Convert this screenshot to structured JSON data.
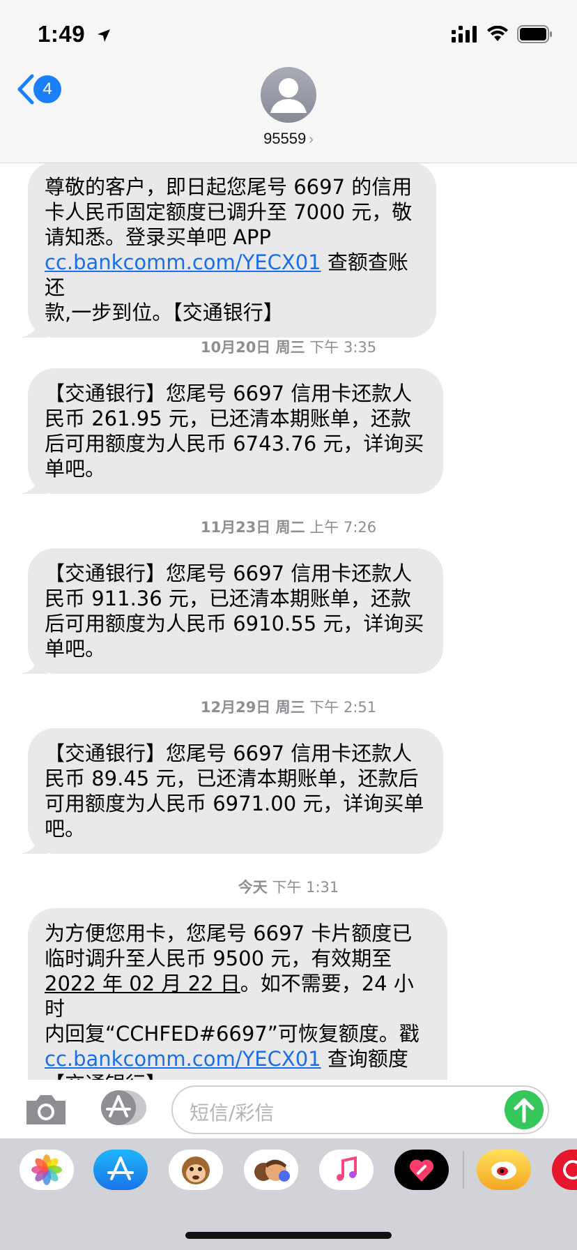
{
  "status_bar": {
    "time": "1:49"
  },
  "header": {
    "unread_count": "4",
    "contact_name": "95559",
    "chevron": "›"
  },
  "messages": [
    {
      "parts": [
        "尊敬的客户，即日起您尾号 6697 的信用",
        "卡人民币固定额度已调升至 7000 元，敬",
        "请知悉。登录买单吧 APP"
      ],
      "link": "cc.bankcomm.com/YECX01",
      "after_link": " 查额查账还",
      "tail": "款,一步到位。【交通银行】"
    },
    {
      "timestamp_date": "10月20日 周三",
      "timestamp_time": " 下午 3:35",
      "lines": [
        "【交通银行】您尾号 6697 信用卡还款人",
        "民币 261.95 元，已还清本期账单，还款",
        "后可用额度为人民币 6743.76 元，详询买",
        "单吧。"
      ]
    },
    {
      "timestamp_date": "11月23日 周二",
      "timestamp_time": " 上午 7:26",
      "lines": [
        "【交通银行】您尾号 6697 信用卡还款人",
        "民币 911.36 元，已还清本期账单，还款",
        "后可用额度为人民币 6910.55 元，详询买",
        "单吧。"
      ]
    },
    {
      "timestamp_date": "12月29日 周三",
      "timestamp_time": " 下午 2:51",
      "lines": [
        "【交通银行】您尾号 6697 信用卡还款人",
        "民币 89.45 元，已还清本期账单，还款后",
        "可用额度为人民币 6971.00 元，详询买单",
        "吧。"
      ]
    },
    {
      "timestamp_date": "今天",
      "timestamp_time": " 下午 1:31",
      "line1": "为方便您用卡，您尾号 6697 卡片额度已",
      "line2": "临时调升至人民币 9500 元，有效期至",
      "line3_underlined": "2022 年 02 月 22 日",
      "line3_rest": "。如不需要，24 小时",
      "line4": "内回复“CCHFED#6697”可恢复额度。戳",
      "link": "cc.bankcomm.com/YECX01",
      "after_link": " 查询额度",
      "line6": "【交通银行】"
    }
  ],
  "input_bar": {
    "placeholder": "短信/彩信"
  },
  "dock": {
    "icons": [
      "photos-icon",
      "app-store-icon",
      "memoji-monkey-icon",
      "memoji-icon",
      "music-icon",
      "digital-touch-icon",
      "weibo-icon",
      "partial-app-icon"
    ]
  },
  "colors": {
    "bubble": "#e9e9eb",
    "link": "#1a6fe8",
    "accent": "#1b7ffa",
    "send": "#35c759",
    "timestamp": "#8e8e93"
  }
}
